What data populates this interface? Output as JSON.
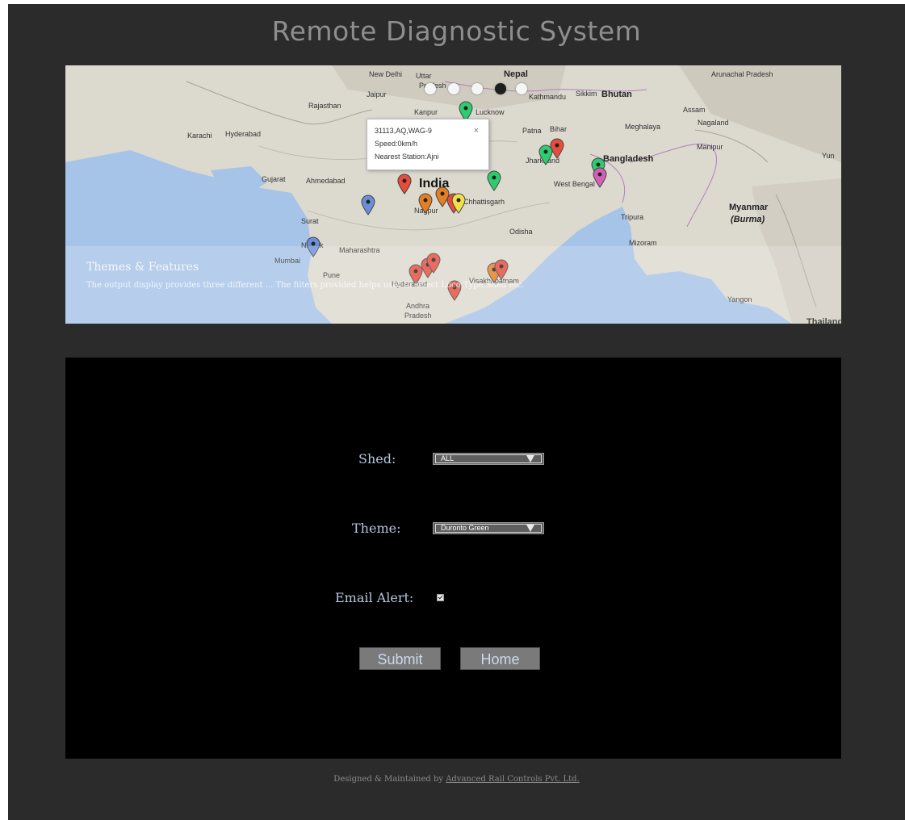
{
  "header": {
    "title": "Remote Diagnostic System"
  },
  "map": {
    "places": [
      {
        "name": "New Delhi"
      },
      {
        "name": "Uttar"
      },
      {
        "name": "Pradesh"
      },
      {
        "name": "Nepal"
      },
      {
        "name": "Kathmandu"
      },
      {
        "name": "Sikkim"
      },
      {
        "name": "Bhutan"
      },
      {
        "name": "Arunachal Pradesh"
      },
      {
        "name": "Assam"
      },
      {
        "name": "Nagaland"
      },
      {
        "name": "Meghalaya"
      },
      {
        "name": "Manipur"
      },
      {
        "name": "Rajasthan"
      },
      {
        "name": "Jaipur"
      },
      {
        "name": "Kanpur"
      },
      {
        "name": "Lucknow"
      },
      {
        "name": "Karachi"
      },
      {
        "name": "Hyderabad"
      },
      {
        "name": "Patna"
      },
      {
        "name": "Bihar"
      },
      {
        "name": "Jharkhand"
      },
      {
        "name": "Bangladesh"
      },
      {
        "name": "Gujarat"
      },
      {
        "name": "Ahmedabad"
      },
      {
        "name": "India"
      },
      {
        "name": "Chhattisgarh"
      },
      {
        "name": "West Bengal"
      },
      {
        "name": "Nagpur"
      },
      {
        "name": "Surat"
      },
      {
        "name": "Nashik"
      },
      {
        "name": "Mumbai"
      },
      {
        "name": "Maharashtra"
      },
      {
        "name": "Pune"
      },
      {
        "name": "Odisha"
      },
      {
        "name": "Tripura"
      },
      {
        "name": "Mizoram"
      },
      {
        "name": "Myanmar"
      },
      {
        "name": "(Burma)"
      },
      {
        "name": "Hyderabad"
      },
      {
        "name": "Visakhapatnam"
      },
      {
        "name": "Andhra"
      },
      {
        "name": "Pradesh"
      },
      {
        "name": "Yangon"
      },
      {
        "name": "Thailand"
      },
      {
        "name": "Yun"
      }
    ],
    "markers": [
      {
        "color": "#2ecc71"
      },
      {
        "color": "#2ecc71"
      },
      {
        "color": "#e74c3c"
      },
      {
        "color": "#2ecc71"
      },
      {
        "color": "#d35fb7"
      },
      {
        "color": "#e74c3c"
      },
      {
        "color": "#2ecc71"
      },
      {
        "color": "#e74c3c"
      },
      {
        "color": "#6b8fd6"
      },
      {
        "color": "#e67e22"
      },
      {
        "color": "#e67e22"
      },
      {
        "color": "#e74c3c"
      },
      {
        "color": "#f1e04a"
      },
      {
        "color": "#6b8fd6"
      },
      {
        "color": "#e74c3c"
      },
      {
        "color": "#e74c3c"
      },
      {
        "color": "#e74c3c"
      },
      {
        "color": "#e74c3c"
      },
      {
        "color": "#e67e22"
      },
      {
        "color": "#e74c3c"
      }
    ],
    "slider": {
      "count": 5,
      "active_index": 3
    },
    "infowindow": {
      "line1": "31113,AQ,WAG-9",
      "line2": "Speed:0km/h",
      "line3": "Nearest Station:Ajni",
      "close": "×"
    },
    "caption": {
      "title": "Themes & Features",
      "text": "The output display provides three different ... The filters provided helps user to select Loco,Type,Shed etc."
    }
  },
  "form": {
    "shed": {
      "label": "Shed:",
      "value": "ALL"
    },
    "theme": {
      "label": "Theme:",
      "value": "Duronto Green"
    },
    "email": {
      "label": "Email Alert:",
      "checked": true
    },
    "submit_label": "Submit",
    "home_label": "Home"
  },
  "footer": {
    "prefix": "Designed & Maintained by",
    "link": "Advanced Rail Controls Pvt. Ltd."
  },
  "colors": {
    "frame": "#2b2b2b",
    "panel": "#000000",
    "title": "#8e8e8e",
    "label": "#b8c6de"
  }
}
